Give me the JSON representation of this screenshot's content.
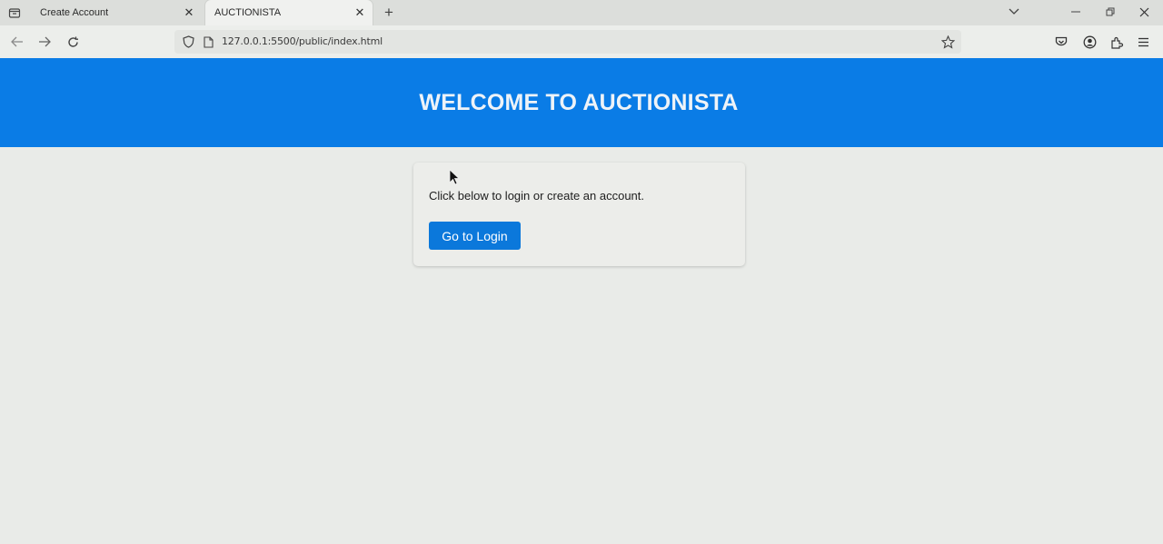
{
  "browser": {
    "tabs": [
      {
        "title": "Create Account",
        "active": false
      },
      {
        "title": "AUCTIONISTA",
        "active": true
      }
    ],
    "new_tab_icon": "plus-icon",
    "url": "127.0.0.1:5500/public/index.html"
  },
  "page": {
    "header_title": "WELCOME TO AUCTIONISTA",
    "header_color": "#0a7ce6",
    "card": {
      "text": "Click below to login or create an account.",
      "button_label": "Go to Login",
      "button_color": "#0b78db"
    }
  }
}
